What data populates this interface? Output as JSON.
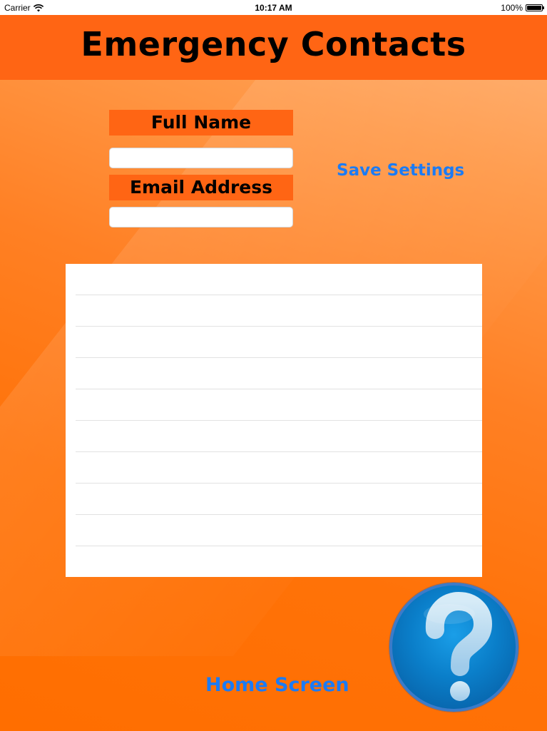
{
  "status_bar": {
    "carrier": "Carrier",
    "time": "10:17 AM",
    "battery": "100%",
    "battery_level": 1.0,
    "wifi_icon": "wifi-icon",
    "battery_icon": "battery-icon"
  },
  "header": {
    "title": "Emergency Contacts"
  },
  "form": {
    "full_name_label": "Full Name",
    "full_name_value": "",
    "email_label": "Email Address",
    "email_value": ""
  },
  "actions": {
    "save_label": "Save Settings",
    "home_label": "Home Screen",
    "help_icon": "question-mark-icon"
  },
  "contacts_table": {
    "rows": [
      "",
      "",
      "",
      "",
      "",
      "",
      "",
      "",
      "",
      ""
    ]
  },
  "colors": {
    "accent": "#ff6514",
    "link": "#1b7bf5",
    "background": "#ff7a1a",
    "help_button": "#0a7ec9"
  }
}
